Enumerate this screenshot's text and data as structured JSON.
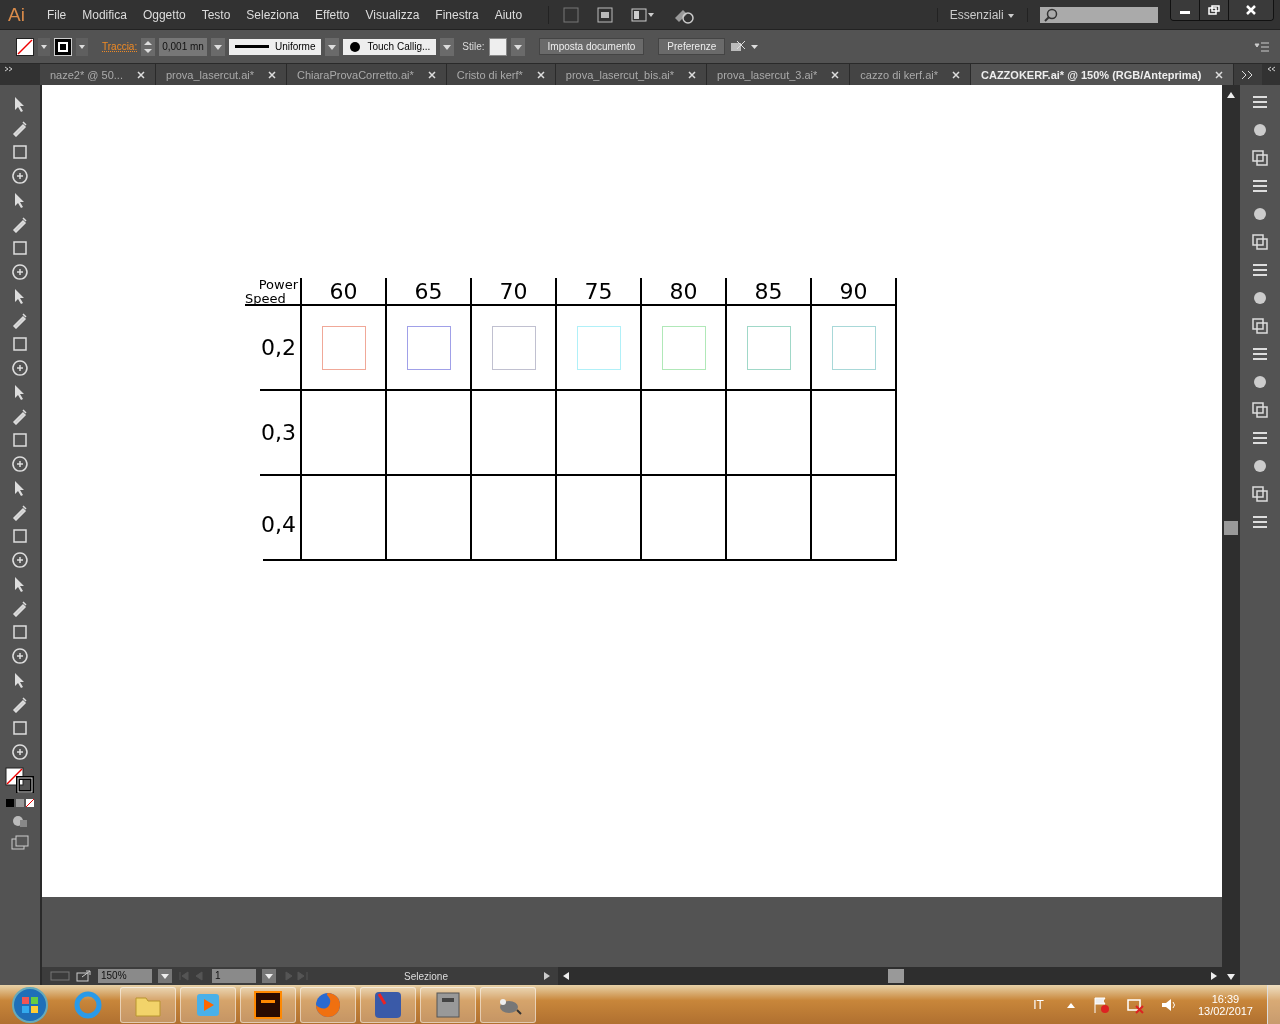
{
  "app": {
    "logo": "Ai"
  },
  "menu": [
    "File",
    "Modifica",
    "Oggetto",
    "Testo",
    "Seleziona",
    "Effetto",
    "Visualizza",
    "Finestra",
    "Aiuto"
  ],
  "workspace": {
    "label": "Essenziali"
  },
  "control_bar": {
    "stroke_label": "Traccia:",
    "stroke_weight": "0,001 mn",
    "profile": "Uniforme",
    "brush": "Touch Callig...",
    "style_label": "Stile:",
    "buttons": [
      "Imposta documento",
      "Preferenze"
    ]
  },
  "tabs": [
    {
      "label": "naze2* @ 50...",
      "selected": false
    },
    {
      "label": "prova_lasercut.ai*",
      "selected": false
    },
    {
      "label": "ChiaraProvaCorretto.ai*",
      "selected": false
    },
    {
      "label": "Cristo di kerf*",
      "selected": false
    },
    {
      "label": "prova_lasercut_bis.ai*",
      "selected": false
    },
    {
      "label": "prova_lasercut_3.ai*",
      "selected": false
    },
    {
      "label": "cazzo di kerf.ai*",
      "selected": false
    },
    {
      "label": "CAZZOKERF.ai* @ 150% (RGB/Anteprima)",
      "selected": true
    }
  ],
  "artwork": {
    "power_label": "Power",
    "speed_label": "Speed",
    "columns": [
      "60",
      "65",
      "70",
      "75",
      "80",
      "85",
      "90"
    ],
    "rows": [
      "0,2",
      "0,3",
      "0,4"
    ],
    "squares": [
      {
        "color": "#f0a898"
      },
      {
        "color": "#a0a0e8"
      },
      {
        "color": "#c0c0d0"
      },
      {
        "color": "#b0f0f8"
      },
      {
        "color": "#b0e8b8"
      },
      {
        "color": "#a0d8c8"
      },
      {
        "color": "#a8d8d8"
      }
    ]
  },
  "status_bar": {
    "zoom": "150%",
    "artboard": "1",
    "tool": "Selezione"
  },
  "taskbar": {
    "language": "IT",
    "time": "16:39",
    "date": "13/02/2017"
  }
}
